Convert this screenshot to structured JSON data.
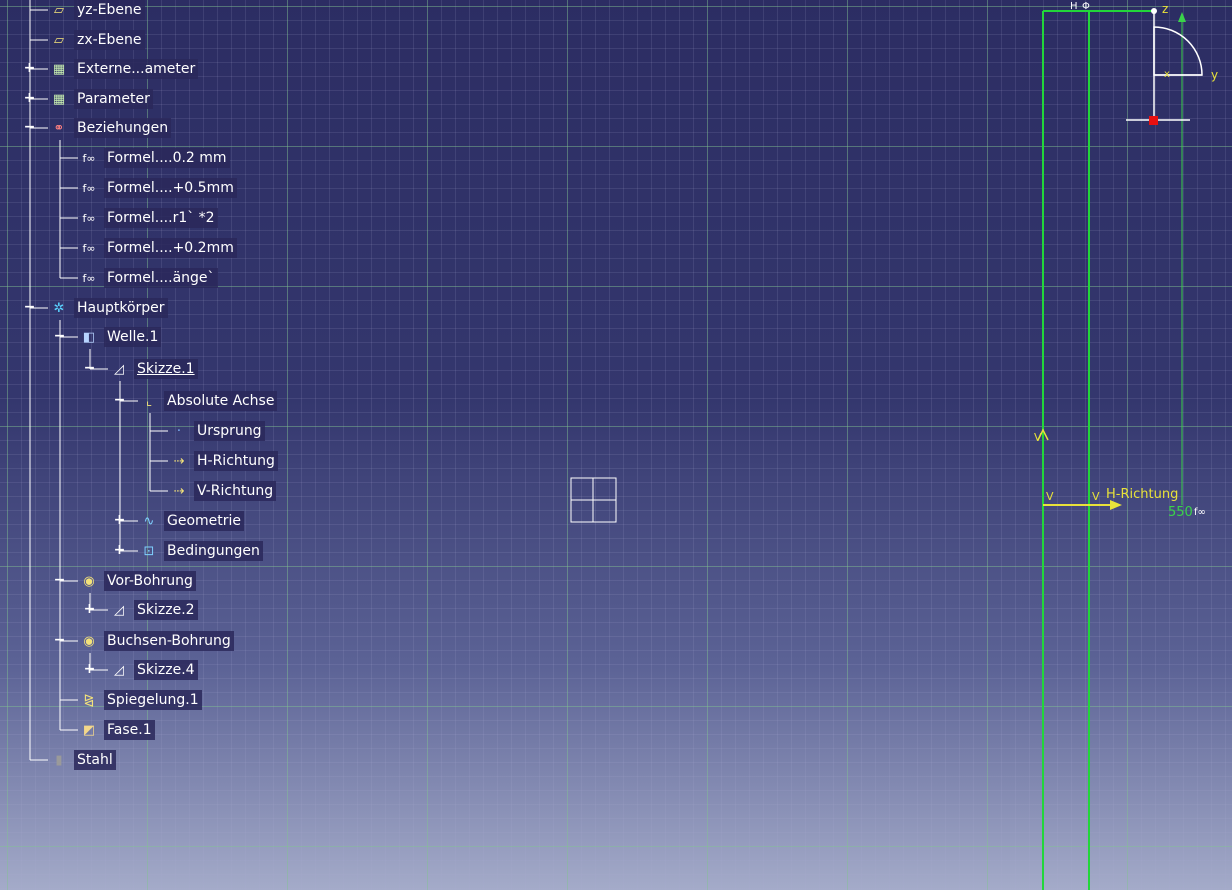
{
  "tree": {
    "nodes": [
      {
        "label": "yz-Ebene",
        "icon": "plane-icon",
        "state": "leaf"
      },
      {
        "label": "zx-Ebene",
        "icon": "plane-icon",
        "state": "leaf"
      },
      {
        "label": "Externe...ameter",
        "icon": "parameter-set-icon",
        "state": "collapsed"
      },
      {
        "label": "Parameter",
        "icon": "parameter-set-icon",
        "state": "collapsed"
      },
      {
        "label": "Beziehungen",
        "icon": "relations-icon",
        "state": "expanded"
      },
      {
        "label": "Formel....0.2 mm",
        "icon": "formula-icon",
        "state": "leaf"
      },
      {
        "label": "Formel....+0.5mm",
        "icon": "formula-icon",
        "state": "leaf"
      },
      {
        "label": "Formel....r1` *2",
        "icon": "formula-icon",
        "state": "leaf"
      },
      {
        "label": "Formel....+0.2mm",
        "icon": "formula-icon",
        "state": "leaf"
      },
      {
        "label": "Formel....änge`",
        "icon": "formula-icon",
        "state": "leaf"
      },
      {
        "label": "Hauptkörper",
        "icon": "body-gear-icon",
        "state": "expanded"
      },
      {
        "label": "Welle.1",
        "icon": "shaft-icon",
        "state": "expanded"
      },
      {
        "label": "Skizze.1",
        "icon": "sketch-icon",
        "state": "expanded",
        "active": true
      },
      {
        "label": "Absolute Achse",
        "icon": "axis-icon",
        "state": "expanded"
      },
      {
        "label": "Ursprung",
        "icon": "origin-point-icon",
        "state": "leaf"
      },
      {
        "label": "H-Richtung",
        "icon": "direction-arrow-icon",
        "state": "leaf"
      },
      {
        "label": "V-Richtung",
        "icon": "direction-arrow-icon",
        "state": "leaf"
      },
      {
        "label": "Geometrie",
        "icon": "geometry-icon",
        "state": "collapsed"
      },
      {
        "label": "Bedingungen",
        "icon": "constraints-icon",
        "state": "collapsed"
      },
      {
        "label": "Vor-Bohrung",
        "icon": "hole-icon",
        "state": "expanded"
      },
      {
        "label": "Skizze.2",
        "icon": "sketch-icon",
        "state": "collapsed"
      },
      {
        "label": "Buchsen-Bohrung",
        "icon": "hole-icon",
        "state": "expanded"
      },
      {
        "label": "Skizze.4",
        "icon": "sketch-icon",
        "state": "collapsed"
      },
      {
        "label": "Spiegelung.1",
        "icon": "mirror-icon",
        "state": "leaf"
      },
      {
        "label": "Fase.1",
        "icon": "chamfer-icon",
        "state": "leaf"
      },
      {
        "label": "Stahl",
        "icon": "material-icon",
        "state": "leaf"
      }
    ]
  },
  "viewport": {
    "h_label_top": "H",
    "v_label_a": "V",
    "v_label_b": "V",
    "v_label_left": "V",
    "h_direction_label": "H-Richtung",
    "dimension_value": "550",
    "compass": {
      "z": "z",
      "y": "y",
      "x": "x"
    },
    "colors": {
      "sketch_green": "#22d63a",
      "axis_yellow": "#e8e23a",
      "dimension_green": "#3ad24a",
      "background_top": "#2c2d63",
      "background_bottom": "#a4abc9"
    }
  }
}
